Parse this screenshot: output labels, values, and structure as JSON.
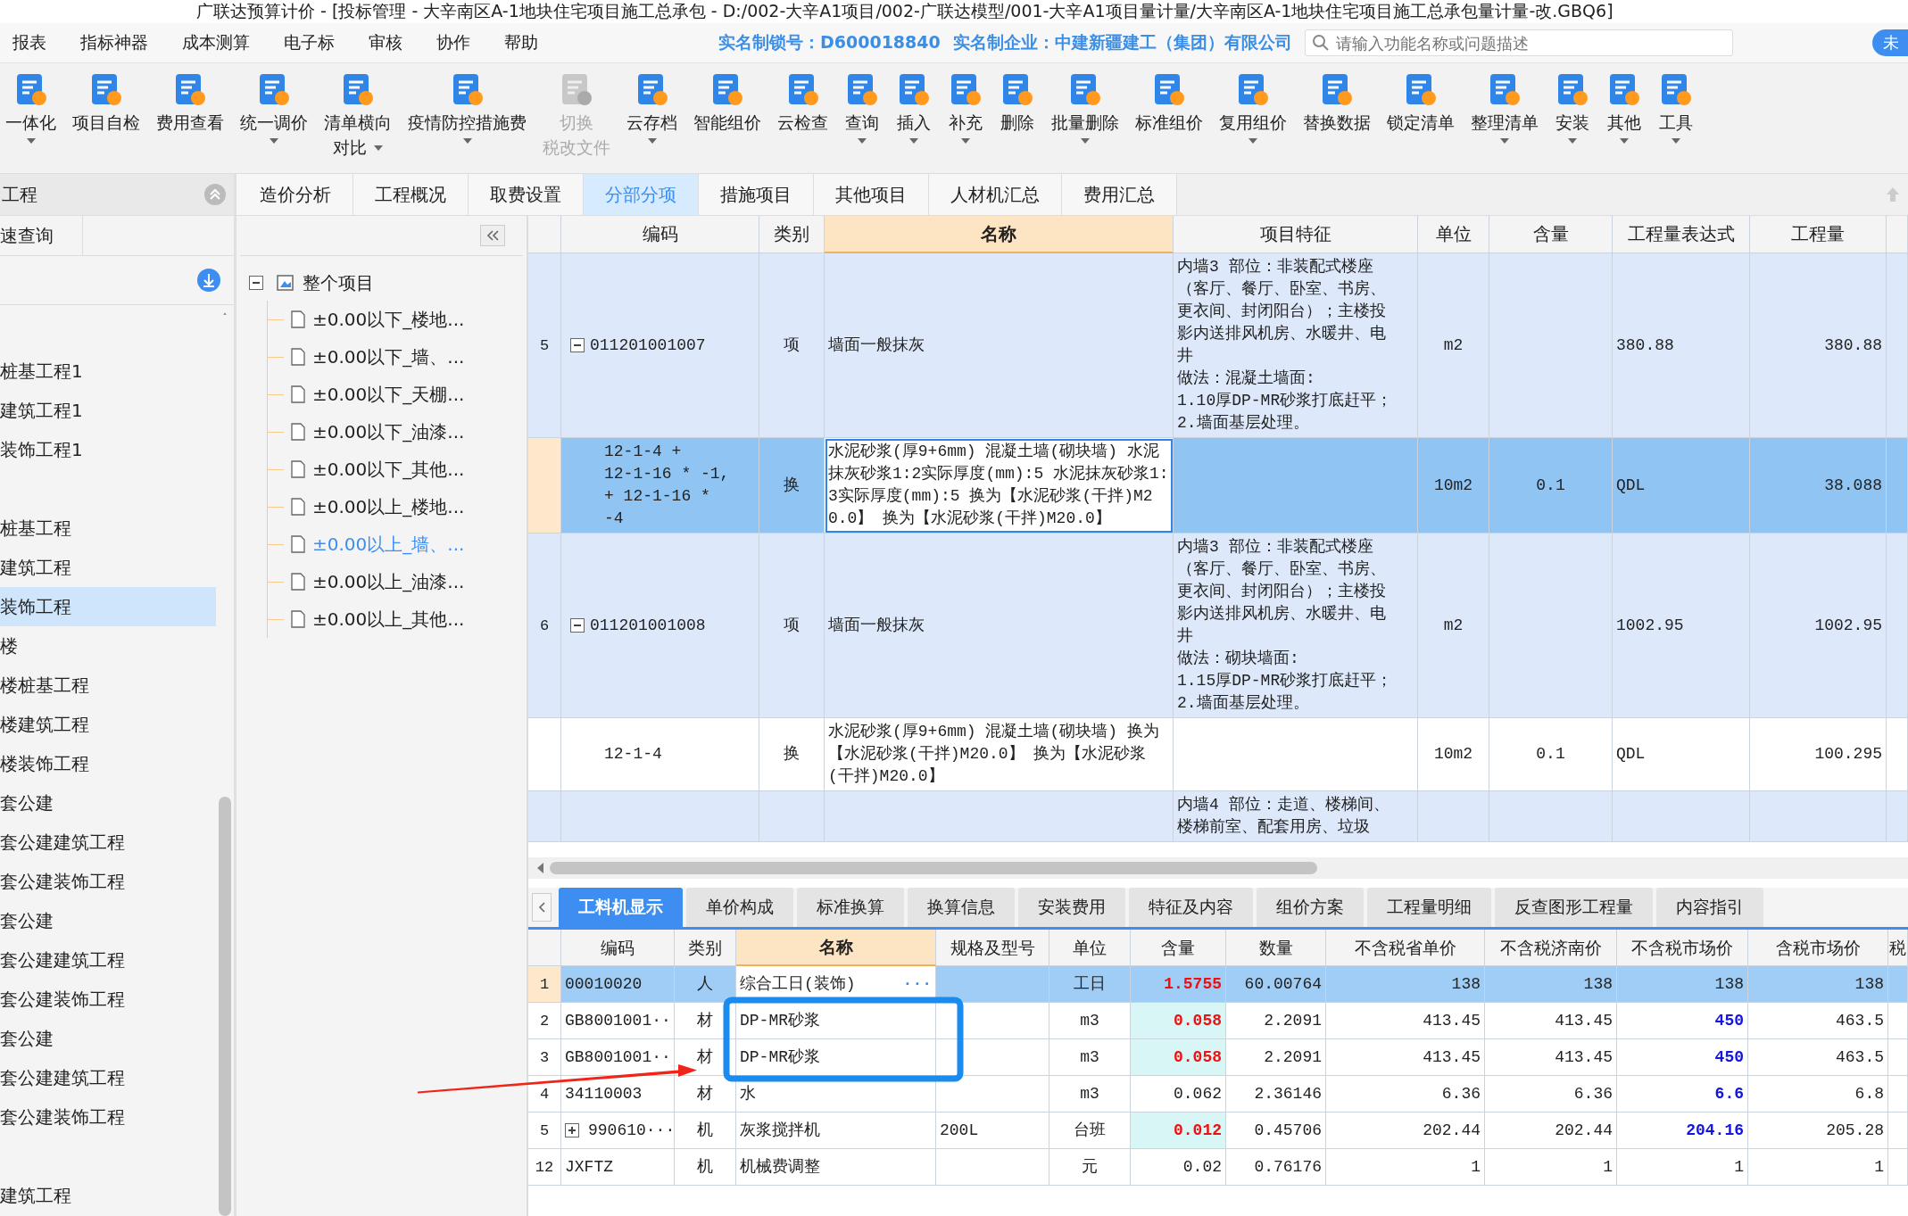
{
  "window": {
    "title": "广联达预算计价 - [投标管理 - 大辛南区A-1地块住宅项目施工总承包 - D:/002-大辛A1项目/002-广联达模型/001-大辛A1项目量计量/大辛南区A-1地块住宅项目施工总承包量计量-改.GBQ6]"
  },
  "menu": [
    "报表",
    "指标神器",
    "成本测算",
    "电子标",
    "审核",
    "协作",
    "帮助"
  ],
  "license": {
    "lock": "实名制锁号：D600018840",
    "company": "实名制企业：中建新疆建工（集团）有限公司"
  },
  "search": {
    "placeholder": "请输入功能名称或问题描述"
  },
  "account_button": "未",
  "toolbar": [
    {
      "label": "一体化",
      "dropdown": true,
      "disabled": false
    },
    {
      "label": "项目自检",
      "dropdown": false,
      "disabled": false
    },
    {
      "label": "费用查看",
      "dropdown": false,
      "disabled": false
    },
    {
      "label": "统一调价",
      "dropdown": true,
      "disabled": false
    },
    {
      "label": "清单横向",
      "label_2": "对比",
      "dropdown": true,
      "disabled": false
    },
    {
      "label": "疫情防控措施费",
      "dropdown": true,
      "disabled": false
    },
    {
      "label": "切换",
      "label_2": "税改文件",
      "dropdown": false,
      "disabled": true
    },
    {
      "label": "云存档",
      "dropdown": true,
      "disabled": false
    },
    {
      "label": "智能组价",
      "dropdown": false,
      "disabled": false
    },
    {
      "label": "云检查",
      "dropdown": false,
      "disabled": false
    },
    {
      "label": "查询",
      "dropdown": true,
      "disabled": false
    },
    {
      "label": "插入",
      "dropdown": true,
      "disabled": false
    },
    {
      "label": "补充",
      "dropdown": true,
      "disabled": false
    },
    {
      "label": "删除",
      "dropdown": false,
      "disabled": false
    },
    {
      "label": "批量删除",
      "dropdown": true,
      "disabled": false
    },
    {
      "label": "标准组价",
      "dropdown": false,
      "disabled": false
    },
    {
      "label": "复用组价",
      "dropdown": true,
      "disabled": false
    },
    {
      "label": "替换数据",
      "dropdown": false,
      "disabled": false
    },
    {
      "label": "锁定清单",
      "dropdown": false,
      "disabled": false
    },
    {
      "label": "整理清单",
      "dropdown": true,
      "disabled": false
    },
    {
      "label": "安装",
      "dropdown": true,
      "disabled": false
    },
    {
      "label": "其他",
      "dropdown": true,
      "disabled": false
    },
    {
      "label": "工具",
      "dropdown": true,
      "disabled": false
    }
  ],
  "project_panel": {
    "title": "工程",
    "tab": "速查询",
    "items": [
      {
        "kind": "blank"
      },
      {
        "kind": "text",
        "label": "桩基工程1",
        "selected": false
      },
      {
        "kind": "text",
        "label": "建筑工程1",
        "selected": false
      },
      {
        "kind": "text",
        "label": "装饰工程1",
        "selected": false
      },
      {
        "kind": "blank"
      },
      {
        "kind": "text",
        "label": "桩基工程",
        "selected": false
      },
      {
        "kind": "text",
        "label": "建筑工程",
        "selected": false
      },
      {
        "kind": "text",
        "label": "装饰工程",
        "selected": true
      },
      {
        "kind": "text",
        "label": "楼",
        "selected": false
      },
      {
        "kind": "text",
        "label": "楼桩基工程",
        "selected": false
      },
      {
        "kind": "text",
        "label": "楼建筑工程",
        "selected": false
      },
      {
        "kind": "text",
        "label": "楼装饰工程",
        "selected": false
      },
      {
        "kind": "text",
        "label": "套公建",
        "selected": false
      },
      {
        "kind": "text",
        "label": "套公建建筑工程",
        "selected": false
      },
      {
        "kind": "text",
        "label": "套公建装饰工程",
        "selected": false
      },
      {
        "kind": "text",
        "label": "套公建",
        "selected": false
      },
      {
        "kind": "text",
        "label": "套公建建筑工程",
        "selected": false
      },
      {
        "kind": "text",
        "label": "套公建装饰工程",
        "selected": false
      },
      {
        "kind": "text",
        "label": "套公建",
        "selected": false
      },
      {
        "kind": "text",
        "label": "套公建建筑工程",
        "selected": false
      },
      {
        "kind": "text",
        "label": "套公建装饰工程",
        "selected": false
      },
      {
        "kind": "blank"
      },
      {
        "kind": "text",
        "label": "建筑工程",
        "selected": false
      }
    ]
  },
  "tabs": [
    {
      "label": "造价分析",
      "selected": false
    },
    {
      "label": "工程概况",
      "selected": false
    },
    {
      "label": "取费设置",
      "selected": false
    },
    {
      "label": "分部分项",
      "selected": true
    },
    {
      "label": "措施项目",
      "selected": false
    },
    {
      "label": "其他项目",
      "selected": false
    },
    {
      "label": "人材机汇总",
      "selected": false
    },
    {
      "label": "费用汇总",
      "selected": false
    }
  ],
  "tree": {
    "label": "整个项目",
    "expanded": true,
    "children": [
      {
        "label": "±0.00以下_楼地...",
        "selected": false
      },
      {
        "label": "±0.00以下_墙、...",
        "selected": false
      },
      {
        "label": "±0.00以下_天棚...",
        "selected": false
      },
      {
        "label": "±0.00以下_油漆...",
        "selected": false
      },
      {
        "label": "±0.00以下_其他...",
        "selected": false
      },
      {
        "label": "±0.00以上_楼地...",
        "selected": false
      },
      {
        "label": "±0.00以上_墙、...",
        "selected": true
      },
      {
        "label": "±0.00以上_油漆...",
        "selected": false
      },
      {
        "label": "±0.00以上_其他...",
        "selected": false
      }
    ]
  },
  "bill_table": {
    "columns": [
      {
        "label": "编码",
        "selected": false
      },
      {
        "label": "类别",
        "selected": false
      },
      {
        "label": "名称",
        "selected": true
      },
      {
        "label": "项目特征",
        "selected": false
      },
      {
        "label": "单位",
        "selected": false
      },
      {
        "label": "含量",
        "selected": false
      },
      {
        "label": "工程量表达式",
        "selected": false
      },
      {
        "label": "工程量",
        "selected": false
      }
    ],
    "rows": [
      {
        "kind": "bill",
        "num": "5",
        "expanded": true,
        "code": "011201001007",
        "category": "项",
        "name": "墙面一般抹灰",
        "features": [
          "内墙3 部位：非装配式楼座（客厅、餐厅、卧室、书房、更衣间、封闭阳台）；主楼投影内送排风机房、水暖井、电井",
          "做法：混凝土墙面:",
          "1.10厚DP-MR砂浆打底赶平；",
          "2.墙面基层处理。"
        ],
        "unit": "m2",
        "expression": "380.88",
        "quantity": "380.88",
        "selected": false
      },
      {
        "kind": "norm",
        "code": "12-1-4 +\n12-1-16 * -1,\n+ 12-1-16 *\n-4",
        "category": "换",
        "name": "水泥砂浆(厚9+6mm) 混凝土墙(砌块墙) 水泥抹灰砂浆1:2实际厚度(mm):5  水泥抹灰砂浆1:3实际厚度(mm):5  换为【水泥砂浆(干拌)M20.0】  换为【水泥砂浆(干拌)M20.0】",
        "unit": "10m2",
        "content": "0.1",
        "expression": "QDL",
        "quantity": "38.088",
        "selected": true
      },
      {
        "kind": "bill",
        "num": "6",
        "expanded": true,
        "code": "011201001008",
        "category": "项",
        "name": "墙面一般抹灰",
        "features": [
          "内墙3 部位：非装配式楼座（客厅、餐厅、卧室、书房、更衣间、封闭阳台）；主楼投影内送排风机房、水暖井、电井",
          "做法：砌块墙面:",
          "1.15厚DP-MR砂浆打底赶平；",
          "2.墙面基层处理。"
        ],
        "unit": "m2",
        "expression": "1002.95",
        "quantity": "1002.95",
        "selected": false
      },
      {
        "kind": "norm",
        "code": "12-1-4",
        "category": "换",
        "name": "水泥砂浆(厚9+6mm) 混凝土墙(砌块墙) 换为【水泥砂浆(干拌)M20.0】  换为【水泥砂浆(干拌)M20.0】",
        "unit": "10m2",
        "content": "0.1",
        "expression": "QDL",
        "quantity": "100.295",
        "selected": false
      },
      {
        "kind": "bill",
        "features": [
          "内墙4 部位：走道、楼梯间、楼梯前室、配套用房、垃圾"
        ],
        "selected": false
      }
    ]
  },
  "detail_tabs": [
    {
      "label": "工料机显示",
      "selected": true
    },
    {
      "label": "单价构成",
      "selected": false
    },
    {
      "label": "标准换算",
      "selected": false
    },
    {
      "label": "换算信息",
      "selected": false
    },
    {
      "label": "安装费用",
      "selected": false
    },
    {
      "label": "特征及内容",
      "selected": false
    },
    {
      "label": "组价方案",
      "selected": false
    },
    {
      "label": "工程量明细",
      "selected": false
    },
    {
      "label": "反查图形工程量",
      "selected": false
    },
    {
      "label": "内容指引",
      "selected": false
    }
  ],
  "resource_table": {
    "columns": [
      {
        "label": "编码",
        "selected": false
      },
      {
        "label": "类别",
        "selected": false
      },
      {
        "label": "名称",
        "selected": true
      },
      {
        "label": "规格及型号",
        "selected": false
      },
      {
        "label": "单位",
        "selected": false
      },
      {
        "label": "含量",
        "selected": false
      },
      {
        "label": "数量",
        "selected": false
      },
      {
        "label": "不含税省单价",
        "selected": false
      },
      {
        "label": "不含税济南价",
        "selected": false
      },
      {
        "label": "不含税市场价",
        "selected": false
      },
      {
        "label": "含税市场价",
        "selected": false
      },
      {
        "label": "税",
        "selected": false
      }
    ],
    "rows": [
      {
        "num": "1",
        "code": "00010020",
        "category": "人",
        "name": "综合工日(装饰)",
        "picker": "···",
        "unit": "工日",
        "content": "1.5755",
        "qty": "60.00764",
        "prov_price": "138",
        "jinan_price": "138",
        "market_price": "138",
        "tax_market_price": "138",
        "selected": true,
        "content_adjusted": true,
        "market_adjusted": false,
        "expandable": false
      },
      {
        "num": "2",
        "code": "GB8001001···",
        "category": "材",
        "name": "DP-MR砂浆",
        "unit": "m3",
        "content": "0.058",
        "qty": "2.2091",
        "prov_price": "413.45",
        "jinan_price": "413.45",
        "market_price": "450",
        "tax_market_price": "463.5",
        "selected": false,
        "content_adjusted": true,
        "market_adjusted": true,
        "expandable": false
      },
      {
        "num": "3",
        "code": "GB8001001···",
        "category": "材",
        "name": "DP-MR砂浆",
        "unit": "m3",
        "content": "0.058",
        "qty": "2.2091",
        "prov_price": "413.45",
        "jinan_price": "413.45",
        "market_price": "450",
        "tax_market_price": "463.5",
        "selected": false,
        "content_adjusted": true,
        "market_adjusted": true,
        "expandable": false
      },
      {
        "num": "4",
        "code": "34110003",
        "category": "材",
        "name": "水",
        "unit": "m3",
        "content": "0.062",
        "qty": "2.36146",
        "prov_price": "6.36",
        "jinan_price": "6.36",
        "market_price": "6.6",
        "tax_market_price": "6.8",
        "selected": false,
        "content_adjusted": false,
        "market_adjusted": true,
        "expandable": false
      },
      {
        "num": "5",
        "code": "990610···",
        "category": "机",
        "name": "灰浆搅拌机",
        "spec": "200L",
        "unit": "台班",
        "content": "0.012",
        "qty": "0.45706",
        "prov_price": "202.44",
        "jinan_price": "202.44",
        "market_price": "204.16",
        "tax_market_price": "205.28",
        "selected": false,
        "content_adjusted": true,
        "market_adjusted": true,
        "expandable": true
      },
      {
        "num": "12",
        "code": "JXFTZ",
        "category": "机",
        "name": "机械费调整",
        "unit": "元",
        "content": "0.02",
        "qty": "0.76176",
        "prov_price": "1",
        "jinan_price": "1",
        "market_price": "1",
        "tax_market_price": "1",
        "selected": false,
        "content_adjusted": false,
        "market_adjusted": false,
        "expandable": false
      }
    ]
  }
}
